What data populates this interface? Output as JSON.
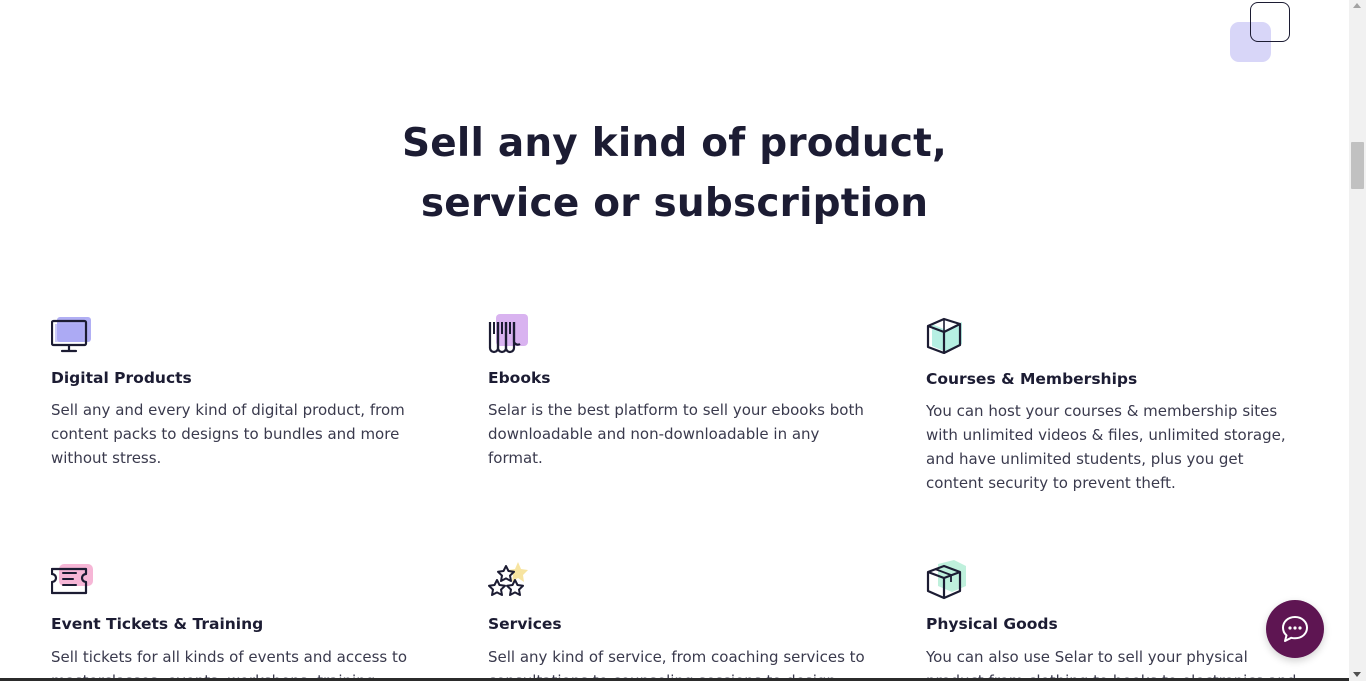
{
  "headline": {
    "line1": "Sell any kind of product,",
    "line2": "service or subscription"
  },
  "features": [
    {
      "icon": "monitor-icon",
      "title": "Digital Products",
      "description": "Sell any and every kind of digital product, from content packs to designs to bundles and more without stress."
    },
    {
      "icon": "ebook-icon",
      "title": "Ebooks",
      "description": "Selar is the best platform to sell your ebooks both downloadable and non-downloadable in any format."
    },
    {
      "icon": "open-book-icon",
      "title": "Courses & Memberships",
      "description": "You can host your courses & membership sites with unlimited videos & files, unlimited storage, and have unlimited students, plus you get content security to prevent theft."
    },
    {
      "icon": "ticket-icon",
      "title": "Event Tickets & Training",
      "description": "Sell tickets for all kinds of events and access to masterclasses, events, workshops, training"
    },
    {
      "icon": "stars-icon",
      "title": "Services",
      "description": "Sell any kind of service, from coaching services to consultations to counseling sessions to design"
    },
    {
      "icon": "box-icon",
      "title": "Physical Goods",
      "description": "You can also use Selar to sell your physical product from clothing to books to electronics and"
    }
  ],
  "chat": {
    "icon": "chat-bubble-icon"
  },
  "colors": {
    "text": "#1c1c33",
    "chat_button": "#5e1552",
    "accent_lavender": "#d8d6f8",
    "monitor_accent": "#a9a6f3",
    "ebook_accent": "#d9b3f0",
    "book_accent": "#b6efe3",
    "ticket_accent": "#f6b6d6",
    "stars_accent": "#f7e4a0",
    "box_accent": "#bff0dc"
  }
}
